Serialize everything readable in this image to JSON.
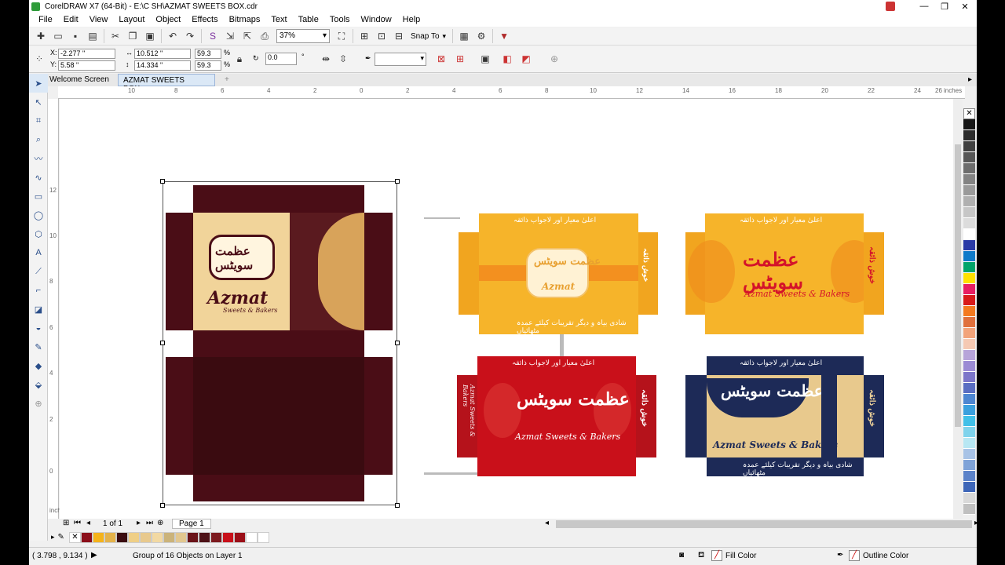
{
  "window": {
    "title": "CorelDRAW X7 (64-Bit) - E:\\C SH\\AZMAT SWEETS BOX.cdr"
  },
  "menu": [
    "File",
    "Edit",
    "View",
    "Layout",
    "Object",
    "Effects",
    "Bitmaps",
    "Text",
    "Table",
    "Tools",
    "Window",
    "Help"
  ],
  "toolbar": {
    "zoom": "37%",
    "snap_to": "Snap To"
  },
  "props": {
    "x": "-2.277 \"",
    "y": "5.58 \"",
    "w": "10.512 \"",
    "h": "14.334 \"",
    "scale_w": "59.3",
    "scale_h": "59.3",
    "pct": "%",
    "angle": "0.0",
    "deg": "°"
  },
  "tabs": {
    "welcome": "Welcome Screen",
    "doc": "AZMAT SWEETS BOX.c..."
  },
  "ruler": {
    "unit": "inches",
    "h_ticks": [
      "10",
      "8",
      "6",
      "4",
      "2",
      "0",
      "2",
      "4",
      "6",
      "8",
      "10",
      "12",
      "14",
      "16",
      "18",
      "20",
      "22",
      "24",
      "26"
    ],
    "v_ticks": [
      "12",
      "10",
      "8",
      "6",
      "4",
      "2",
      "0"
    ]
  },
  "artwork": {
    "brand": "Azmat",
    "brand_sub": "Sweets & Bakers",
    "brand_full": "Azmat Sweets & Bakers",
    "urdu_title": "عظمت سویٹس",
    "urdu_tag": "شادی بیاہ و دیگر تقریبات کیلئے عمدہ مٹھائیاں",
    "urdu_top": "اعلیٰ معیار اور لاجواب ذائقہ",
    "urdu_side": "خوش ذائقہ"
  },
  "pages": {
    "count": "1 of 1",
    "page": "Page 1"
  },
  "status": {
    "coords": "( 3.798 , 9.134 )",
    "selection": "Group of 16 Objects on Layer 1",
    "fill": "Fill Color",
    "outline": "Outline Color"
  },
  "palette": [
    "#151515",
    "#2b2b2b",
    "#414141",
    "#575757",
    "#6d6d6d",
    "#838383",
    "#9a9a9a",
    "#b0b0b0",
    "#c6c6c6",
    "#dcdcdc",
    "#ffffff",
    "#2a3aa6",
    "#0f7ac9",
    "#00a56a",
    "#ffe100",
    "#e81e63",
    "#d91a1a",
    "#f47a20",
    "#e0703c",
    "#f2a37a",
    "#f5c9b3",
    "#b7a4d9",
    "#9b8bd4",
    "#7c76c9",
    "#5a6ec2",
    "#4d86d1",
    "#3aa0de",
    "#41c0e8",
    "#7fd3ec",
    "#b8e7f3",
    "#a8c3e6",
    "#7fa3d8",
    "#5b82c9",
    "#3e66b8",
    "#d9d9d9",
    "#c0c0c0"
  ],
  "doc_palette": [
    "#8b0e19",
    "#f5b31b",
    "#e4b24a",
    "#3a0b10",
    "#efcf86",
    "#e8c98d",
    "#f2d9a3",
    "#cbb37a",
    "#e2c78f",
    "#6b1419",
    "#4e1217",
    "#7d1a1f",
    "#c8101a",
    "#9b0f18",
    "#ffffff",
    "#ffffff"
  ],
  "colors": {
    "accent": "#f6b42a",
    "maroon": "#4a0d16",
    "red": "#c9101a",
    "navy": "#1d2a57"
  }
}
